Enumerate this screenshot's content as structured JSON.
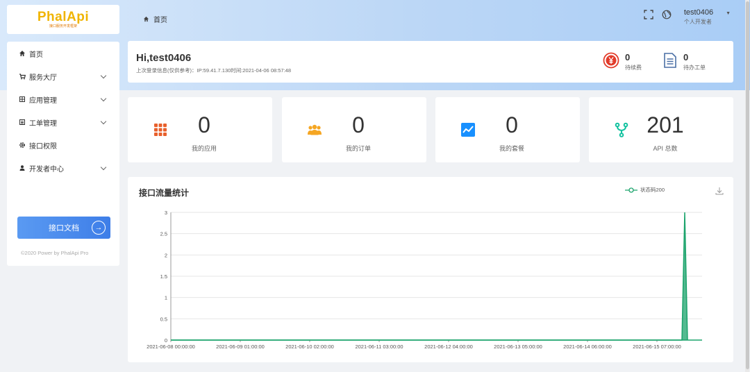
{
  "logo": {
    "text": "PhalApi",
    "subtitle": "接口服务开发框架"
  },
  "header": {
    "breadcrumb": "首页",
    "user_name": "test0406",
    "user_role": "个人开发者"
  },
  "sidebar": {
    "items": [
      {
        "label": "首页",
        "icon": "home-icon",
        "has_children": false
      },
      {
        "label": "服务大厅",
        "icon": "cart-icon",
        "has_children": true
      },
      {
        "label": "应用管理",
        "icon": "grid-icon",
        "has_children": true
      },
      {
        "label": "工单管理",
        "icon": "list-icon",
        "has_children": true
      },
      {
        "label": "接口权限",
        "icon": "gear-icon",
        "has_children": false
      },
      {
        "label": "开发者中心",
        "icon": "user-icon",
        "has_children": true
      }
    ],
    "doc_button": "接口文档",
    "copyright": "©2020 Power by PhalApi Pro"
  },
  "welcome": {
    "title": "Hi,test0406",
    "last_login": "上次登录信息(仅供参考)：IP:59.41.7.130时间:2021-04-06 08:57:48",
    "pending_payment_count": "0",
    "pending_payment_label": "待续费",
    "pending_ticket_count": "0",
    "pending_ticket_label": "待办工单"
  },
  "cards": [
    {
      "value": "0",
      "label": "我的应用",
      "icon": "apps-grid-icon",
      "color": "#e8602c"
    },
    {
      "value": "0",
      "label": "我的订单",
      "icon": "people-icon",
      "color": "#f5a623"
    },
    {
      "value": "0",
      "label": "我的套餐",
      "icon": "trend-chart-icon",
      "color": "#1890ff"
    },
    {
      "value": "201",
      "label": "API 总数",
      "icon": "fork-icon",
      "color": "#13c2a0"
    }
  ],
  "chart_section": {
    "title": "接口流量统计",
    "legend": "状态码200"
  },
  "chart_data": {
    "type": "area",
    "x_tick_labels": [
      "2021-06-08 00:00:00",
      "2021-06-09 01:00:00",
      "2021-06-10 02:00:00",
      "2021-06-11 03:00:00",
      "2021-06-12 04:00:00",
      "2021-06-13 05:00:00",
      "2021-06-14 06:00:00",
      "2021-06-15 07:00:00"
    ],
    "y_tick_labels": [
      "0",
      "0.5",
      "1",
      "1.5",
      "2",
      "2.5",
      "3"
    ],
    "ylim": [
      0,
      3
    ],
    "grid": true,
    "legend_position": "top-right",
    "series": [
      {
        "name": "状态码200",
        "color": "#1aa36b",
        "points_note_free": true,
        "points": [
          {
            "x": "2021-06-08 00:00:00",
            "y": 0
          },
          {
            "x": "2021-06-15 16:00:00",
            "y": 0
          },
          {
            "x": "2021-06-15 17:00:00",
            "y": 3
          },
          {
            "x": "2021-06-15 18:00:00",
            "y": 0
          }
        ]
      }
    ]
  }
}
